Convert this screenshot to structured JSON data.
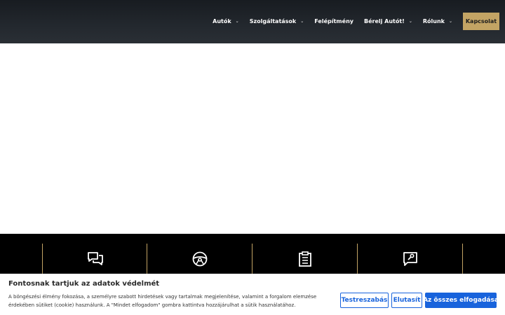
{
  "nav": {
    "items": [
      {
        "label": "Autók",
        "has_dropdown": true
      },
      {
        "label": "Szolgáltatások",
        "has_dropdown": true
      },
      {
        "label": "Felépítmény",
        "has_dropdown": false
      },
      {
        "label": "Bérelj Autót!",
        "has_dropdown": true
      },
      {
        "label": "Rólunk",
        "has_dropdown": true
      }
    ],
    "contact_label": "Kapcsolat",
    "chevron": "⌄"
  },
  "features": {
    "icons": [
      "chat-icon",
      "steering-wheel-icon",
      "clipboard-icon",
      "support-chat-icon"
    ],
    "accent_color": "#c3a464"
  },
  "cookie": {
    "title": "Fontosnak tartjuk az adatok védelmét",
    "text": "A böngészési élmény fokozása, a személyre szabott hirdetések vagy tartalmak megjelenítése, valamint a forgalom elemzése érdekében sütiket (cookie) használunk. A \"Mindet elfogadom\" gombra kattintva hozzájárulhat a sütik használatához.",
    "customize_label": "Testreszabás",
    "reject_label": "Elutasít",
    "accept_label": "Az összes elfogadása",
    "button_color": "#1863dc"
  }
}
